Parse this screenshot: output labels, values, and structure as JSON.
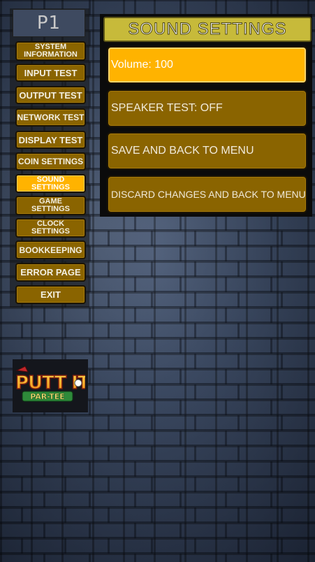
{
  "sidebar": {
    "player": "P1",
    "items": [
      {
        "label": "SYSTEM\nINFORMATION",
        "active": false
      },
      {
        "label": "INPUT TEST",
        "active": false
      },
      {
        "label": "OUTPUT TEST",
        "active": false
      },
      {
        "label": "NETWORK TEST",
        "active": false
      },
      {
        "label": "DISPLAY TEST",
        "active": false
      },
      {
        "label": "COIN SETTINGS",
        "active": false
      },
      {
        "label": "SOUND\nSETTINGS",
        "active": true
      },
      {
        "label": "GAME\nSETTINGS",
        "active": false
      },
      {
        "label": "CLOCK\nSETTINGS",
        "active": false
      },
      {
        "label": "BOOKKEEPING",
        "active": false
      },
      {
        "label": "ERROR PAGE",
        "active": false
      },
      {
        "label": "EXIT",
        "active": false
      }
    ]
  },
  "panel": {
    "title": "SOUND SETTINGS",
    "options": [
      {
        "label": "Volume: 100",
        "active": true
      },
      {
        "label": "SPEAKER TEST:  OFF",
        "active": false
      },
      {
        "label": "SAVE AND BACK TO MENU",
        "active": false
      },
      {
        "label": "DISCARD CHANGES AND BACK TO MENU",
        "active": false
      }
    ]
  },
  "logo": {
    "text_top": "PUTT IT!",
    "text_bottom": "PAR-TEE"
  },
  "colors": {
    "button_idle": "#8a6400",
    "button_active": "#ffb300",
    "title_bar": "#c7ba3a",
    "wall": "#2f3d57"
  }
}
